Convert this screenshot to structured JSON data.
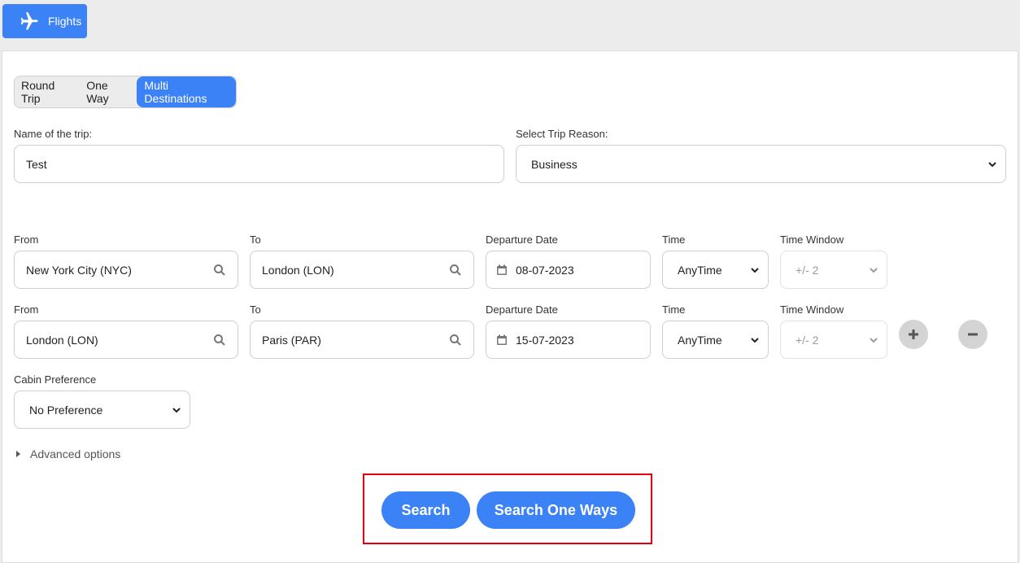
{
  "tab": {
    "label": "Flights",
    "icon": "airplane-icon"
  },
  "trip_types": [
    {
      "label": "Round Trip",
      "active": false
    },
    {
      "label": "One Way",
      "active": false
    },
    {
      "label": "Multi Destinations",
      "active": true
    }
  ],
  "trip_name": {
    "label": "Name of the trip:",
    "value": "Test"
  },
  "trip_reason": {
    "label": "Select Trip Reason:",
    "value": "Business"
  },
  "legs": [
    {
      "from_label": "From",
      "from": "New York City (NYC)",
      "to_label": "To",
      "to": "London (LON)",
      "date_label": "Departure Date",
      "date": "08-07-2023",
      "time_label": "Time",
      "time": "AnyTime",
      "window_label": "Time Window",
      "window": "+/- 2"
    },
    {
      "from_label": "From",
      "from": "London (LON)",
      "to_label": "To",
      "to": "Paris (PAR)",
      "date_label": "Departure Date",
      "date": "15-07-2023",
      "time_label": "Time",
      "time": "AnyTime",
      "window_label": "Time Window",
      "window": "+/- 2"
    }
  ],
  "cabin": {
    "label": "Cabin Preference",
    "value": "No Preference"
  },
  "advanced_options": "Advanced options",
  "buttons": {
    "search": "Search",
    "search_one_ways": "Search One Ways"
  },
  "colors": {
    "accent": "#3b82f6",
    "highlight": "#e0000f",
    "background": "#ececec"
  }
}
